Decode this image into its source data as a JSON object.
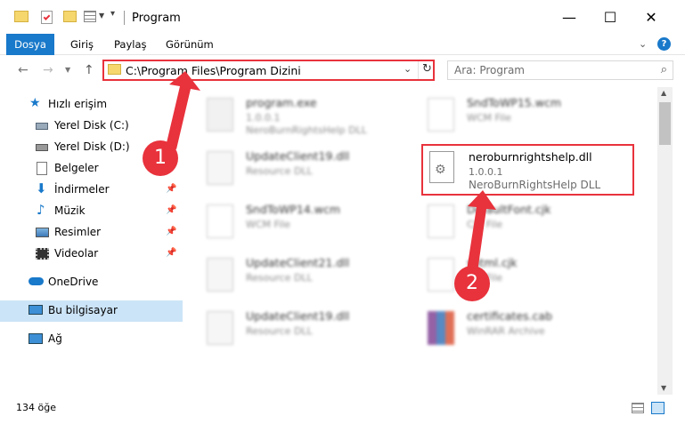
{
  "window": {
    "title": "Program",
    "controls": {
      "minimize": "—",
      "maximize": "☐",
      "close": "✕"
    }
  },
  "ribbon": {
    "tabs": [
      "Dosya",
      "Giriş",
      "Paylaş",
      "Görünüm"
    ]
  },
  "address": {
    "path": "C:\\Program Files\\Program Dizini",
    "search_placeholder": "Ara: Program"
  },
  "sidebar": {
    "quick_access": "Hızlı erişim",
    "items": [
      {
        "label": "Yerel Disk (C:)",
        "icon": "drive-icon"
      },
      {
        "label": "Yerel Disk (D:)",
        "icon": "drive-icon"
      },
      {
        "label": "Belgeler",
        "icon": "documents-icon"
      },
      {
        "label": "İndirmeler",
        "icon": "downloads-icon"
      },
      {
        "label": "Müzik",
        "icon": "music-icon"
      },
      {
        "label": "Resimler",
        "icon": "pictures-icon"
      },
      {
        "label": "Videolar",
        "icon": "videos-icon"
      }
    ],
    "onedrive": "OneDrive",
    "this_pc": "Bu bilgisayar",
    "network": "Ağ"
  },
  "files": [
    {
      "name": "program.exe",
      "line1": "1.0.0.1",
      "line2": "NeroBurnRightsHelp DLL"
    },
    {
      "name": "SndToWP15.wcm",
      "line1": "WCM File",
      "line2": ""
    },
    {
      "name": "UpdateClient19.dll",
      "line1": "Resource DLL",
      "line2": ""
    },
    {
      "name": "neroburnrightshelp.dll",
      "line1": "1.0.0.1",
      "line2": "NeroBurnRightsHelp DLL"
    },
    {
      "name": "SndToWP14.wcm",
      "line1": "WCM File",
      "line2": ""
    },
    {
      "name": "DefaultFont.cjk",
      "line1": "CJK File",
      "line2": ""
    },
    {
      "name": "UpdateClient21.dll",
      "line1": "Resource DLL",
      "line2": ""
    },
    {
      "name": "shtml.cjk",
      "line1": "CJK File",
      "line2": ""
    },
    {
      "name": "UpdateClient19.dll",
      "line1": "Resource DLL",
      "line2": ""
    },
    {
      "name": "certificates.cab",
      "line1": "WinRAR Archive",
      "line2": ""
    }
  ],
  "status": {
    "count": "134 öğe"
  },
  "annotations": {
    "badge1": "1",
    "badge2": "2"
  },
  "colors": {
    "accent": "#1979ca",
    "highlight": "#e8323c",
    "selection": "#cce4f7"
  }
}
